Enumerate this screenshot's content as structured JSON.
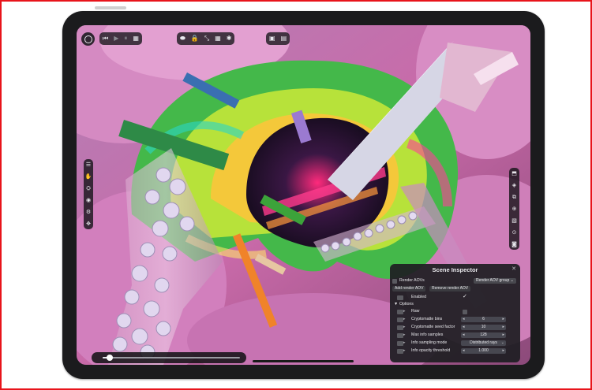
{
  "toolbar": {
    "group1": [
      "⏮",
      "▶",
      "⏸",
      "▦"
    ],
    "group2": [
      "⬬",
      "🔒",
      "⤡",
      "▦",
      "✱"
    ],
    "group3": [
      "▣",
      "▤"
    ]
  },
  "left_rail": [
    "☰",
    "✋",
    "⛭",
    "◉",
    "⚙",
    "✥"
  ],
  "right_rail": [
    "⬒",
    "◈",
    "⧉",
    "⊕",
    "▧",
    "⊙",
    "◙"
  ],
  "slider": {
    "progress": 0.05
  },
  "inspector": {
    "title": "Scene Inspector",
    "render_aov_label": "Render AOVs",
    "render_aov_value": "Render AOV group",
    "add_button": "Add render AOV",
    "remove_button": "Remove render AOV",
    "enabled_label": "Enabled",
    "enabled_check": "✓",
    "options_label": "Options",
    "rows": [
      {
        "label": "Raw",
        "value": ""
      },
      {
        "label": "Cryptomatte bins",
        "value": "6"
      },
      {
        "label": "Cryptomatte seed factor",
        "value": "10"
      },
      {
        "label": "Max info samples",
        "value": "128"
      },
      {
        "label": "Info sampling mode",
        "value": "Distributed rays"
      },
      {
        "label": "Info opacity threshold",
        "value": "1.000"
      }
    ]
  }
}
